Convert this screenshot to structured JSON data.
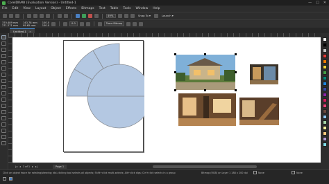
{
  "window": {
    "title": "CorelDRAW (Evaluation Version) - Untitled-1",
    "controls": [
      "—",
      "□",
      "✕"
    ]
  },
  "menu": [
    "File",
    "Edit",
    "View",
    "Layout",
    "Object",
    "Effects",
    "Bitmaps",
    "Text",
    "Table",
    "Tools",
    "Window",
    "Help"
  ],
  "toolbar": {
    "zoom": "49%",
    "snap_label": "Snap To ▾",
    "launch_label": "Launch ▾"
  },
  "properties": {
    "x": "370.489 mm",
    "y": "271.271 mm",
    "w": "143.78 mm",
    "h": "99.65 mm",
    "scale_w": "100.0",
    "scale_h": "100.0",
    "angle": "0.0",
    "trace_label": "Trace Bitmap"
  },
  "document": {
    "tab_label": "Untitled-1"
  },
  "pager": {
    "position": "1 of 1",
    "page_label": "Page 1"
  },
  "status": {
    "hint": "Click an object twice for rotating/skewing; dbl-clicking tool selects all objects; Shift+click multi-selects; Alt+click digs; Ctrl+click selects in a group",
    "info": "Bitmap (RGB) on Layer 1 188 x 200 dpi",
    "fill_label": "None",
    "outline_label": "None"
  },
  "palette_colors": [
    "#ffffff",
    "#000000",
    "#c7c7c7",
    "#e53935",
    "#f57c00",
    "#fdd835",
    "#43a047",
    "#00897b",
    "#1e88e5",
    "#3949ab",
    "#8e24aa",
    "#d81b60",
    "#ec407a",
    "#6d4c41",
    "#90caf9",
    "#a5d6a7",
    "#fff59d",
    "#ffcc80",
    "#b39ddb",
    "#80deea"
  ],
  "colors": {
    "shape_fill": "#b4c8e2",
    "shape_stroke": "#8a8f96"
  }
}
